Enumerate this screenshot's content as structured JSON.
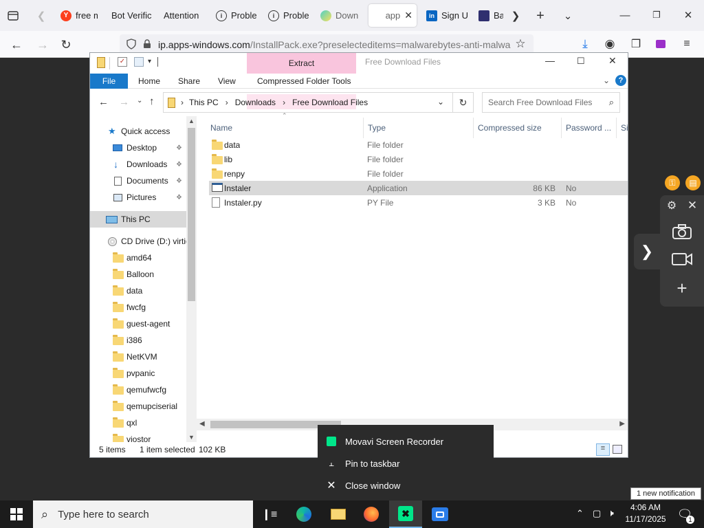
{
  "browser": {
    "tabs": [
      {
        "title": "free m",
        "favicon": "yandex-icon",
        "color": "#fc3f1d"
      },
      {
        "title": "Bot Verific",
        "favicon": "blank"
      },
      {
        "title": "Attention",
        "favicon": "blank"
      },
      {
        "title": "Proble",
        "favicon": "info-icon"
      },
      {
        "title": "Proble",
        "favicon": "info-icon"
      },
      {
        "title": "Down",
        "favicon": "droplet-icon"
      },
      {
        "title": "app",
        "favicon": "blank",
        "active": true
      },
      {
        "title": "Sign U",
        "favicon": "linkedin-icon",
        "color": "#0a66c2"
      },
      {
        "title": "Bar",
        "favicon": "bar-icon",
        "color": "#2f2f6f"
      }
    ],
    "url_host": "ip.apps-windows.com",
    "url_path": "/InstallPack.exe?preselecteditems=malwarebytes-anti-malwa"
  },
  "explorer": {
    "window_title": "Free Download Files",
    "extract_label": "Extract",
    "ribbon_tabs": {
      "file": "File",
      "home": "Home",
      "share": "Share",
      "view": "View",
      "compressed": "Compressed Folder Tools"
    },
    "breadcrumb": [
      "This PC",
      "Downloads",
      "Free Download Files"
    ],
    "search_placeholder": "Search Free Download Files",
    "nav": {
      "quick_access": "Quick access",
      "quick_items": [
        "Desktop",
        "Downloads",
        "Documents",
        "Pictures"
      ],
      "this_pc": "This PC",
      "cd_drive": "CD Drive (D:) virtio",
      "cd_folders": [
        "amd64",
        "Balloon",
        "data",
        "fwcfg",
        "guest-agent",
        "i386",
        "NetKVM",
        "pvpanic",
        "qemufwcfg",
        "qemupciserial",
        "qxl",
        "viostor"
      ]
    },
    "columns": {
      "name": "Name",
      "type": "Type",
      "compressed_size": "Compressed size",
      "password": "Password ...",
      "size": "Si"
    },
    "files": [
      {
        "name": "data",
        "type": "File folder",
        "size": "",
        "password": "",
        "icon": "folder-icon"
      },
      {
        "name": "lib",
        "type": "File folder",
        "size": "",
        "password": "",
        "icon": "folder-icon"
      },
      {
        "name": "renpy",
        "type": "File folder",
        "size": "",
        "password": "",
        "icon": "folder-icon"
      },
      {
        "name": "Instaler",
        "type": "Application",
        "size": "86 KB",
        "password": "No",
        "icon": "application-icon",
        "selected": true
      },
      {
        "name": "Instaler.py",
        "type": "PY File",
        "size": "3 KB",
        "password": "No",
        "icon": "file-icon"
      }
    ],
    "status": {
      "items": "5 items",
      "selected": "1 item selected",
      "size": "102 KB"
    }
  },
  "movavi_panel": {
    "icons": [
      "key-icon",
      "cart-icon",
      "gear-icon",
      "close-icon",
      "camera-icon",
      "video-icon",
      "plus-icon",
      "chevron-right-icon"
    ]
  },
  "jump_list": {
    "app": "Movavi Screen Recorder",
    "pin": "Pin to taskbar",
    "close": "Close window"
  },
  "notification": "1 new notification",
  "taskbar": {
    "search_placeholder": "Type here to search",
    "time": "4:06 AM",
    "date": "11/17/2025",
    "notif_count": "1"
  },
  "colors": {
    "accent": "#1979ca",
    "extract_tab": "#f9c5dd",
    "selection": "#d9d9d9",
    "movavi_green": "#00e68a"
  }
}
